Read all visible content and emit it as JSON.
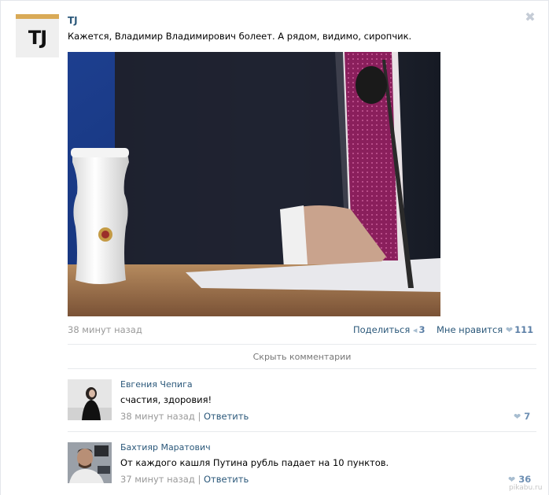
{
  "post": {
    "author": "TJ",
    "avatar_text": "TJ",
    "text": "Кажется, Владимир Владимирович болеет. А рядом, видимо, сиропчик.",
    "time": "38 минут назад",
    "share_label": "Поделиться",
    "share_count": "3",
    "like_label": "Мне нравится",
    "like_count": "111",
    "close_glyph": "✖"
  },
  "hide_comments_label": "Скрыть комментарии",
  "comments": [
    {
      "author": "Евгения Чепига",
      "text": "счастия, здоровия!",
      "time": "38 минут назад",
      "separator": "|",
      "reply_label": "Ответить",
      "likes": "7"
    },
    {
      "author": "Бахтияр Маратович",
      "text": "От каждого кашля Путина рубль падает на 10 пунктов.",
      "time": "37 минут назад",
      "separator": "|",
      "reply_label": "Ответить",
      "likes": "36"
    }
  ],
  "watermark": "pikabu.ru",
  "colors": {
    "link": "#2b587a",
    "muted": "#999999",
    "like_accent": "#5b7fa6",
    "tj_bar": "#d9aa57"
  },
  "icons": {
    "close": "close-icon",
    "share": "megaphone-icon",
    "like": "heart-icon"
  }
}
